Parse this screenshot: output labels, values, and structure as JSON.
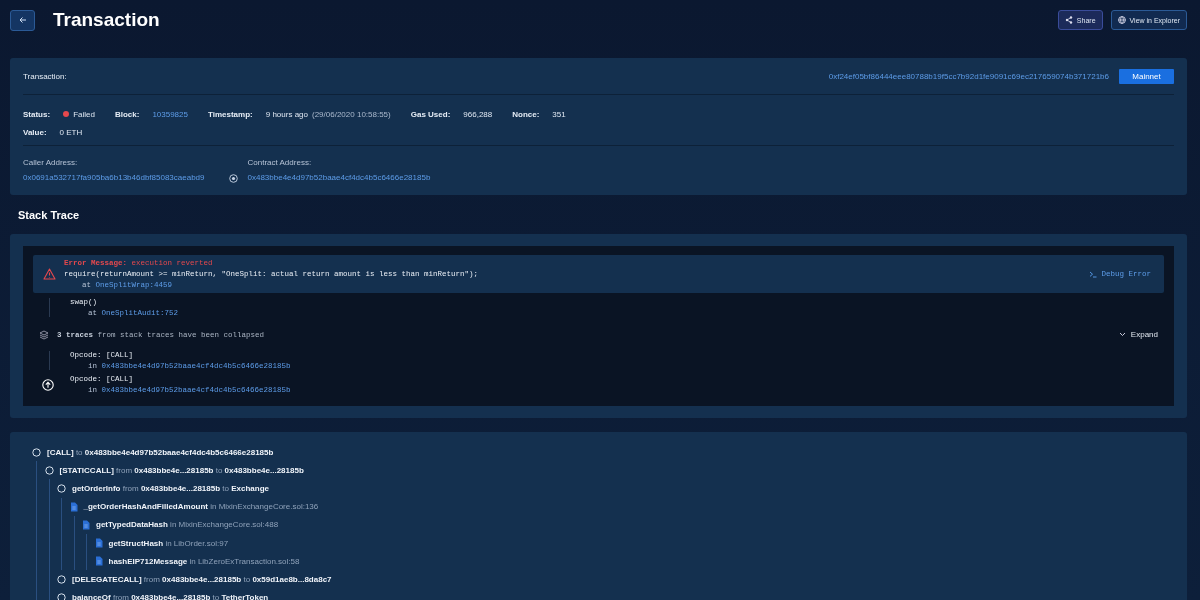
{
  "header": {
    "title": "Transaction",
    "buttons": [
      {
        "label": "Share",
        "kind": "share"
      },
      {
        "label": "View in Explorer",
        "kind": "explorer"
      }
    ]
  },
  "summary": {
    "transaction_label": "Transaction:",
    "hash": "0xf24ef05bf86444eee80788b19f5cc7b92d1fe9091c69ec217659074b371721b6",
    "network": "Mainnet",
    "fields": [
      {
        "label": "Status:",
        "value": "Failed",
        "color": "#e5484d",
        "kind": "status"
      },
      {
        "label": "Block:",
        "value": "10359825",
        "kind": "link"
      },
      {
        "label": "Timestamp:",
        "value": "9 hours ago",
        "note": "(29/06/2020 10:58:55)",
        "kind": "plain"
      },
      {
        "label": "Gas Used:",
        "value": "966,288",
        "kind": "plain"
      },
      {
        "label": "Nonce:",
        "value": "351",
        "kind": "plain"
      }
    ],
    "value_label": "Value:",
    "value": "0 ETH",
    "caller_label": "Caller Address:",
    "caller": "0x0691a532717fa905ba6b13b46dbf85083caeabd9",
    "contract_label": "Contract Address:",
    "contract": "0x483bbe4e4d97b52baae4cf4dc4b5c6466e28185b"
  },
  "stack_trace": {
    "title": "Stack Trace",
    "frames": [
      {
        "kind": "error",
        "label": "Error Message:",
        "message": "execution reverted",
        "code": "require(returnAmount >= minReturn, \"OneSplit: actual return amount is less than minReturn\");",
        "prefix": "at",
        "location": "OneSplitWrap:4459",
        "action": "Debug Error"
      },
      {
        "kind": "frame",
        "code": "swap()",
        "prefix": "at",
        "location": "OneSplitAudit:752"
      },
      {
        "kind": "collapsed",
        "count": "3 traces",
        "text": "from stack traces have been collapsed",
        "action": "Expand"
      },
      {
        "kind": "frame",
        "code": "Opcode: [CALL]",
        "prefix": "in",
        "location": "0x483bbe4e4d97b52baae4cf4dc4b5c6466e28185b"
      },
      {
        "kind": "origin",
        "code": "Opcode: [CALL]",
        "prefix": "in",
        "location": "0x483bbe4e4d97b52baae4cf4dc4b5c6466e28185b"
      }
    ]
  },
  "call_tree": [
    {
      "kind": "call",
      "text": "**[CALL]** to **0x483bbe4e4d97b52baae4cf4dc4b5c6466e28185b**",
      "children": [
        {
          "kind": "call",
          "text": "**[STATICCALL]** from **0x483bbe4e...28185b** to **0x483bbe4e...28185b**",
          "children": [
            {
              "kind": "call",
              "text": "**getOrderInfo** from **0x483bbe4e...28185b** to **Exchange**",
              "children": [
                {
                  "kind": "source",
                  "text": "**_getOrderHashAndFilledAmount** in MixinExchangeCore.sol:136",
                  "children": [
                    {
                      "kind": "source",
                      "text": "**getTypedDataHash** in MixinExchangeCore.sol:488",
                      "children": [
                        {
                          "kind": "source",
                          "text": "**getStructHash** in LibOrder.sol:97"
                        },
                        {
                          "kind": "source",
                          "text": "**hashEIP712Message** in LibZeroExTransaction.sol:58"
                        }
                      ]
                    }
                  ]
                }
              ]
            },
            {
              "kind": "call",
              "text": "**[DELEGATECALL]** from **0x483bbe4e...28185b** to **0x59d1ae8b...8da8c7**"
            },
            {
              "kind": "call",
              "text": "**balanceOf** from **0x483bbe4e...28185b** to **TetherToken**"
            }
          ]
        }
      ]
    }
  ]
}
